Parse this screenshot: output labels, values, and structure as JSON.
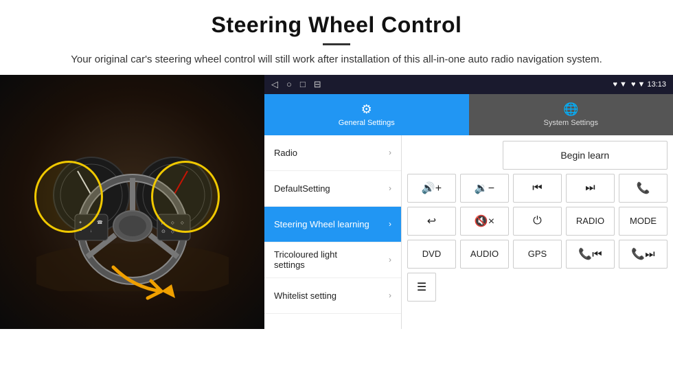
{
  "header": {
    "title": "Steering Wheel Control",
    "subtitle": "Your original car's steering wheel control will still work after installation of this all-in-one auto radio navigation system."
  },
  "status_bar": {
    "nav_icons": [
      "◁",
      "○",
      "□",
      "⊟"
    ],
    "right_info": "♥ ▼ 13:13"
  },
  "tabs": [
    {
      "id": "general",
      "label": "General Settings",
      "icon": "⚙",
      "active": true
    },
    {
      "id": "system",
      "label": "System Settings",
      "icon": "🌐",
      "active": false
    }
  ],
  "menu_items": [
    {
      "id": "radio",
      "label": "Radio",
      "active": false
    },
    {
      "id": "default",
      "label": "DefaultSetting",
      "active": false
    },
    {
      "id": "steering",
      "label": "Steering Wheel learning",
      "active": true
    },
    {
      "id": "tricoloured",
      "label": "Tricoloured light settings",
      "active": false
    },
    {
      "id": "whitelist",
      "label": "Whitelist setting",
      "active": false
    }
  ],
  "control_panel": {
    "begin_learn_label": "Begin learn",
    "row1": [
      {
        "id": "vol-up",
        "label": "🔊+",
        "type": "icon"
      },
      {
        "id": "vol-down",
        "label": "🔉−",
        "type": "icon"
      },
      {
        "id": "prev",
        "label": "⏮",
        "type": "icon"
      },
      {
        "id": "next",
        "label": "⏭",
        "type": "icon"
      },
      {
        "id": "phone",
        "label": "📞",
        "type": "icon"
      }
    ],
    "row2": [
      {
        "id": "hangup",
        "label": "↩",
        "type": "icon"
      },
      {
        "id": "mute",
        "label": "🔇×",
        "type": "icon"
      },
      {
        "id": "power",
        "label": "⏻",
        "type": "icon"
      },
      {
        "id": "radio-btn",
        "label": "RADIO",
        "type": "text"
      },
      {
        "id": "mode",
        "label": "MODE",
        "type": "text"
      }
    ],
    "row3": [
      {
        "id": "dvd",
        "label": "DVD",
        "type": "text"
      },
      {
        "id": "audio",
        "label": "AUDIO",
        "type": "text"
      },
      {
        "id": "gps",
        "label": "GPS",
        "type": "text"
      },
      {
        "id": "tel-prev",
        "label": "📞⏮",
        "type": "icon"
      },
      {
        "id": "tel-next",
        "label": "📞⏭",
        "type": "icon"
      }
    ],
    "row4": [
      {
        "id": "list-icon",
        "label": "≡",
        "type": "icon"
      }
    ]
  }
}
